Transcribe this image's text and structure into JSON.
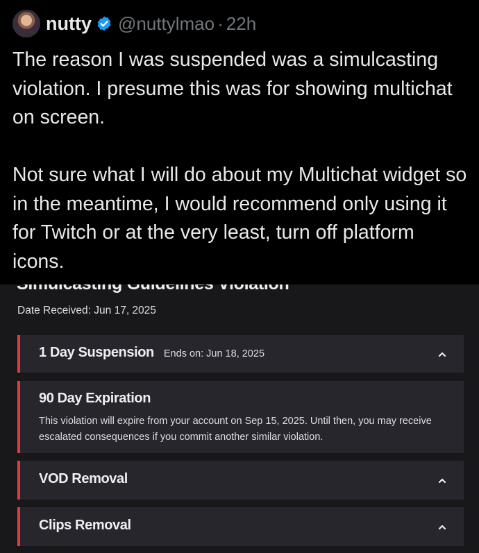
{
  "tweet": {
    "display_name": "nutty",
    "handle": "@nuttylmao",
    "separator": "·",
    "time": "22h",
    "paragraphs": [
      "The reason I was suspended was a simulcasting violation. I presume this was for showing multichat on screen.",
      "Not sure what I will do about my Multichat widget so in the meantime, I would recommend only using it for Twitch or at the very least, turn off platform icons."
    ]
  },
  "screenshot": {
    "title": "Simulcasting Guidelines Violation",
    "date_received": "Date Received: Jun 17, 2025",
    "cards": [
      {
        "title": "1 Day Suspension",
        "subtitle": "Ends on: Jun 18, 2025"
      },
      {
        "title": "90 Day Expiration",
        "description": "This violation will expire from your account on Sep 15, 2025. Until then, you may receive escalated consequences if you commit another similar violation."
      },
      {
        "title": "VOD Removal"
      },
      {
        "title": "Clips Removal"
      }
    ]
  },
  "colors": {
    "background": "#000000",
    "text": "#e7e9ea",
    "muted": "#71767b",
    "verified_blue": "#1d9bf0",
    "panel_bg": "#18181b",
    "card_bg": "#26262c",
    "alert_red": "#e03c3c"
  },
  "icons": [
    "avatar",
    "verified-badge-icon",
    "chevron-up-icon"
  ]
}
